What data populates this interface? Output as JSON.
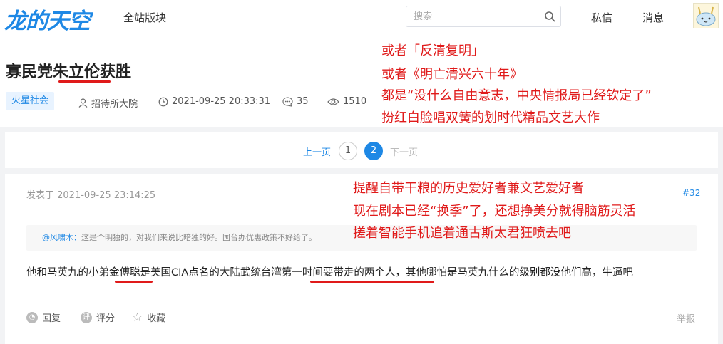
{
  "header": {
    "logo": "龙的天空",
    "nav_all": "全站版块",
    "search_placeholder": "搜索",
    "messages": "私信",
    "notifications": "消息"
  },
  "post": {
    "title": "寡民党朱立伦获胜",
    "category": "火星社会",
    "author": "招待所大院",
    "datetime": "2021-09-25 20:33:31",
    "comments": "35",
    "views": "1510"
  },
  "annotations_top": [
    "或者「反清复明」",
    "或者《明亡清兴六十年》",
    "都是“没什么自由意志，中央情报局已经钦定了”",
    "扮红白脸唱双簧的划时代精品文艺大作"
  ],
  "pagination": {
    "prev": "上一页",
    "pages": [
      "1",
      "2"
    ],
    "current": "2",
    "next": "下一页"
  },
  "reply": {
    "posted": "发表于 2021-09-25 23:14:25",
    "floor": "#32",
    "quote_author": "@风啸木：",
    "quote_text": "这是个明独的，对我们来说比暗独的好。国台办优惠政策不好给了。",
    "body": "他和马英九的小弟金傅聪是美国CIA点名的大陆武统台湾第一时间要带走的两个人，其他哪怕是马英九什么的级别都没他们高，牛逼吧",
    "actions": {
      "reply": "回复",
      "rate": "评分",
      "favorite": "收藏",
      "report": "举报"
    }
  },
  "annotations_reply": [
    "提醒自带干粮的历史爱好者兼文艺爱好者",
    "现在剧本已经“换季”了，还想挣美分就得脑筋灵活",
    "搓着智能手机追着通古斯太君狂喷去吧"
  ],
  "colors": {
    "brand": "#1e88e5",
    "annotation": "#e01a1a"
  }
}
